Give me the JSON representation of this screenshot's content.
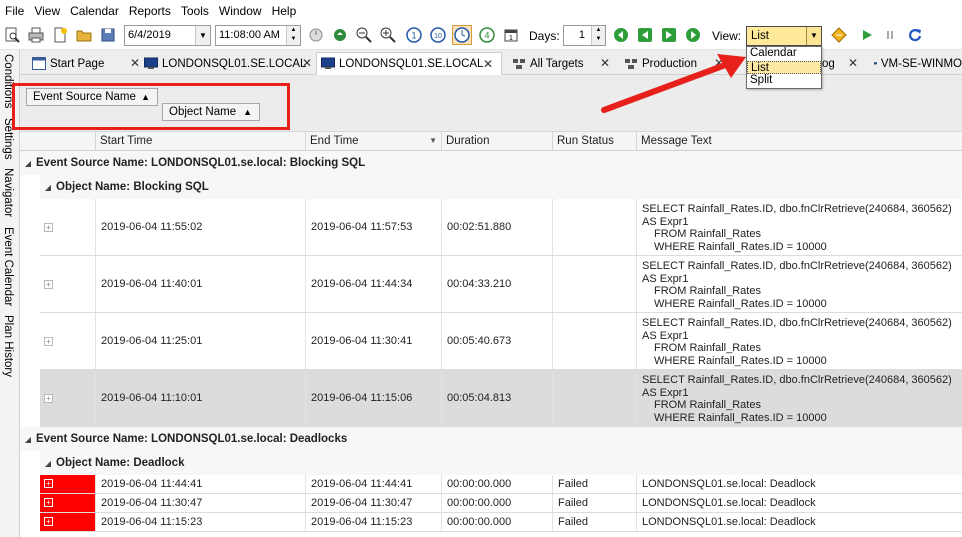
{
  "menu": [
    "File",
    "View",
    "Calendar",
    "Reports",
    "Tools",
    "Window",
    "Help"
  ],
  "toolbar": {
    "date_value": "6/4/2019",
    "time_value": "11:08:00 AM",
    "days_label": "Days:",
    "days_value": "1",
    "view_label": "View:",
    "view_value": "List",
    "view_options": [
      "Calendar",
      "List",
      "Split"
    ]
  },
  "side_tabs": [
    "Conditions",
    "Settings",
    "Navigator",
    "Event Calendar",
    "Plan History"
  ],
  "tabs": [
    "Start Page",
    "LONDONSQL01.SE.LOCAL",
    "LONDONSQL01.SE.LOCAL",
    "All Targets",
    "Production",
    "og",
    "VM-SE-WINMO"
  ],
  "group_chips": [
    "Event Source Name",
    "Object Name"
  ],
  "columns": [
    "Start Time",
    "End Time",
    "Duration",
    "Run Status",
    "Message Text"
  ],
  "groups": [
    {
      "header": "Event Source Name: LONDONSQL01.se.local: Blocking SQL",
      "sub_header": "Object Name: Blocking SQL",
      "rows": [
        {
          "start": "2019-06-04 11:55:02",
          "end": "2019-06-04 11:57:53",
          "duration": "00:02:51.880",
          "status": "",
          "msg": [
            "SELECT Rainfall_Rates.ID, dbo.fnClrRetrieve(240684, 360562) AS Expr1",
            "FROM Rainfall_Rates",
            "WHERE Rainfall_Rates.ID = 10000"
          ]
        },
        {
          "start": "2019-06-04 11:40:01",
          "end": "2019-06-04 11:44:34",
          "duration": "00:04:33.210",
          "status": "",
          "msg": [
            "SELECT Rainfall_Rates.ID, dbo.fnClrRetrieve(240684, 360562) AS Expr1",
            "FROM Rainfall_Rates",
            "WHERE Rainfall_Rates.ID = 10000"
          ]
        },
        {
          "start": "2019-06-04 11:25:01",
          "end": "2019-06-04 11:30:41",
          "duration": "00:05:40.673",
          "status": "",
          "msg": [
            "SELECT Rainfall_Rates.ID, dbo.fnClrRetrieve(240684, 360562) AS Expr1",
            "FROM Rainfall_Rates",
            "WHERE Rainfall_Rates.ID = 10000"
          ]
        },
        {
          "start": "2019-06-04 11:10:01",
          "end": "2019-06-04 11:15:06",
          "duration": "00:05:04.813",
          "status": "",
          "msg": [
            "SELECT Rainfall_Rates.ID, dbo.fnClrRetrieve(240684, 360562) AS Expr1",
            "FROM Rainfall_Rates",
            "WHERE Rainfall_Rates.ID = 10000"
          ]
        }
      ]
    },
    {
      "header": "Event Source Name: LONDONSQL01.se.local: Deadlocks",
      "sub_header": "Object Name: Deadlock",
      "rows": [
        {
          "start": "2019-06-04 11:44:41",
          "end": "2019-06-04 11:44:41",
          "duration": "00:00:00.000",
          "status": "Failed",
          "msg": [
            "LONDONSQL01.se.local: Deadlock"
          ]
        },
        {
          "start": "2019-06-04 11:30:47",
          "end": "2019-06-04 11:30:47",
          "duration": "00:00:00.000",
          "status": "Failed",
          "msg": [
            "LONDONSQL01.se.local: Deadlock"
          ]
        },
        {
          "start": "2019-06-04 11:15:23",
          "end": "2019-06-04 11:15:23",
          "duration": "00:00:00.000",
          "status": "Failed",
          "msg": [
            "LONDONSQL01.se.local: Deadlock"
          ]
        }
      ]
    }
  ],
  "colors": {
    "highlight_red": "#e8201c",
    "failed_cell": "#ff0000",
    "view_combo": "#ffe99a"
  }
}
